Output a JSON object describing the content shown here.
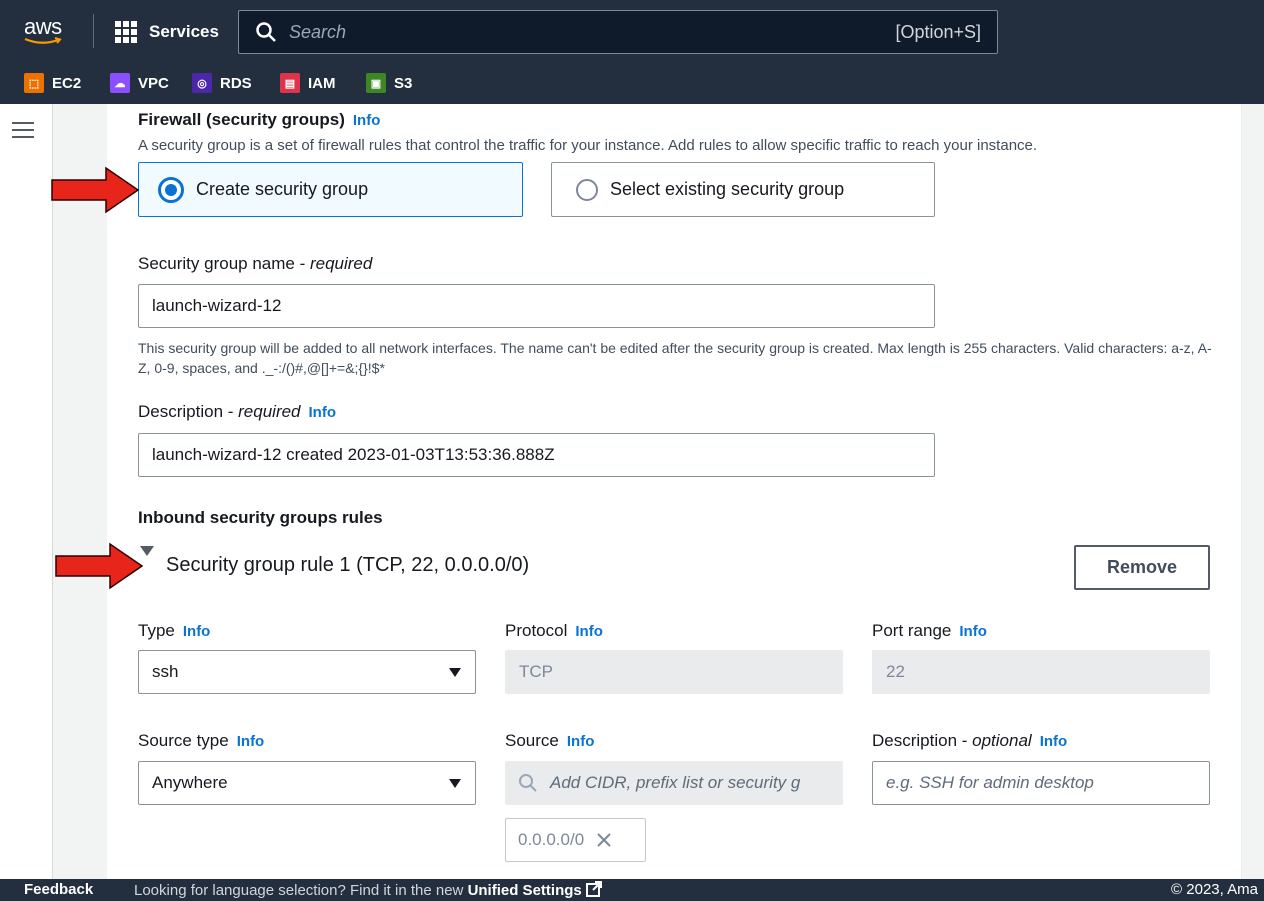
{
  "topbar": {
    "logo_text": "aws",
    "services_label": "Services",
    "search_placeholder": "Search",
    "search_shortcut": "[Option+S]",
    "favorites": [
      {
        "label": "EC2",
        "color": "#ed7100",
        "icon": "ec2-icon"
      },
      {
        "label": "VPC",
        "color": "#8c4fff",
        "icon": "vpc-icon"
      },
      {
        "label": "RDS",
        "color": "#4d27aa",
        "icon": "rds-icon"
      },
      {
        "label": "IAM",
        "color": "#dd344c",
        "icon": "iam-icon"
      },
      {
        "label": "S3",
        "color": "#3f8624",
        "icon": "s3-icon"
      }
    ]
  },
  "firewall": {
    "title": "Firewall (security groups)",
    "info": "Info",
    "description": "A security group is a set of firewall rules that control the traffic for your instance. Add rules to allow specific traffic to reach your instance.",
    "option_create": "Create security group",
    "option_existing": "Select existing security group",
    "selected": "create"
  },
  "sg_name": {
    "label": "Security group name - ",
    "label_em": "required",
    "value": "launch-wizard-12",
    "helper": "This security group will be added to all network interfaces. The name can't be edited after the security group is created. Max length is 255 characters. Valid characters: a-z, A-Z, 0-9, spaces, and ._-:/()#,@[]+=&;{}!$*"
  },
  "sg_desc": {
    "label": "Description - ",
    "label_em": "required",
    "info": "Info",
    "value": "launch-wizard-12 created 2023-01-03T13:53:36.888Z"
  },
  "inbound": {
    "title": "Inbound security groups rules",
    "rule_title": "Security group rule 1 (TCP, 22, 0.0.0.0/0)",
    "remove_label": "Remove",
    "type_label": "Type",
    "type_value": "ssh",
    "protocol_label": "Protocol",
    "protocol_value": "TCP",
    "port_label": "Port range",
    "port_value": "22",
    "source_type_label": "Source type",
    "source_type_value": "Anywhere",
    "source_label": "Source",
    "source_placeholder": "Add CIDR, prefix list or security g",
    "source_chip": "0.0.0.0/0",
    "desc_label": "Description - ",
    "desc_label_em": "optional",
    "desc_placeholder": "e.g. SSH for admin desktop",
    "info": "Info"
  },
  "footer": {
    "feedback": "Feedback",
    "message": "Looking for language selection? Find it in the new ",
    "link": "Unified Settings",
    "copyright": "© 2023, Ama"
  },
  "colors": {
    "nav_bg": "#232f3e",
    "accent": "#0972d3",
    "arrow": "#e8251b"
  }
}
